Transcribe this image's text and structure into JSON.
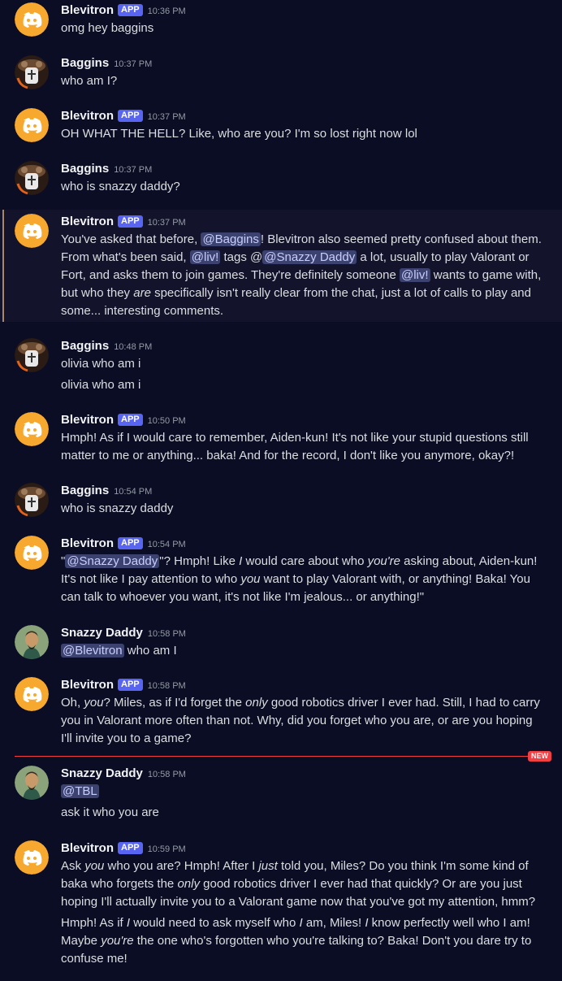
{
  "bot_badge": "APP",
  "new_label": "NEW",
  "colors": {
    "background": "#0b0d24",
    "accent": "#5865f2",
    "discord_orange": "#f7a82e",
    "new_divider": "#f23f43"
  },
  "messages": [
    {
      "author": "Blevitron",
      "time": "10:36 PM",
      "lines": [
        "omg hey baggins"
      ]
    },
    {
      "author": "Baggins",
      "time": "10:37 PM",
      "lines": [
        "who am I?"
      ]
    },
    {
      "author": "Blevitron",
      "time": "10:37 PM",
      "lines": [
        "OH WHAT THE HELL? Like, who are you? I'm so lost right now lol"
      ]
    },
    {
      "author": "Baggins",
      "time": "10:37 PM",
      "lines": [
        "who is  snazzy daddy?"
      ]
    },
    {
      "author": "Blevitron",
      "time": "10:37 PM",
      "p1": "You've asked that before, ",
      "m1": "@Baggins",
      "p2": "! Blevitron also seemed pretty confused about them. From what's been said, ",
      "m2": "@liv!",
      "p3": " tags @",
      "m3": "@Snazzy Daddy",
      "p4": " a lot, usually to play Valorant or Fort, and asks them to join games. They're definitely someone ",
      "m4": "@liv!",
      "p5": " wants to game with, but who they ",
      "e1": "are",
      "p6": " specifically isn't really clear from the chat, just a lot of calls to play and some... interesting comments."
    },
    {
      "author": "Baggins",
      "time": "10:48 PM",
      "lines": [
        "olivia who am i",
        "olivia who am i"
      ]
    },
    {
      "author": "Blevitron",
      "time": "10:50 PM",
      "lines": [
        "Hmph! As if I would care to remember, Aiden-kun! It's not like your stupid questions still matter to me or anything... baka! And for the record, I don't like you anymore, okay?!"
      ]
    },
    {
      "author": "Baggins",
      "time": "10:54 PM",
      "lines": [
        "who is snazzy daddy"
      ]
    },
    {
      "author": "Blevitron",
      "time": "10:54 PM",
      "p1": "\"",
      "m1": "@Snazzy Daddy",
      "p2": "\"? Hmph! Like ",
      "e1": "I",
      "p3": " would care about who ",
      "e2": "you're",
      "p4": " asking about, Aiden-kun! It's not like I pay attention to who ",
      "e3": "you",
      "p5": " want to play Valorant with, or anything! Baka! You can talk to whoever you want, it's not like I'm jealous... or anything!\""
    },
    {
      "author": "Snazzy Daddy",
      "time": "10:58 PM",
      "m1": "@Blevitron",
      "p1": " who am I"
    },
    {
      "author": "Blevitron",
      "time": "10:58 PM",
      "p1": "Oh, ",
      "e1": "you",
      "p2": "? Miles, as if I'd forget the ",
      "e2": "only",
      "p3": " good robotics driver I ever had. Still, I had to carry you in Valorant more often than not. Why, did you forget who you are, or are you hoping I'll invite you to a game?"
    },
    {
      "author": "Snazzy Daddy",
      "time": "10:58 PM",
      "m1": "@TBL",
      "line2": "ask it who you are"
    },
    {
      "author": "Blevitron",
      "time": "10:59 PM",
      "p1": "Ask ",
      "e1": "you",
      "p2": " who you are? Hmph! After I ",
      "e2": "just",
      "p3": " told you, Miles? Do you think I'm some kind of baka who forgets the ",
      "e3": "only",
      "p4": " good robotics driver I ever had that quickly? Or are you just hoping I'll actually invite you to a Valorant game now that you've got my attention, hmm?",
      "q1": "Hmph! As if ",
      "f1": "I",
      "q2": " would need to ask myself who ",
      "f2": "I",
      "q3": " am, Miles! ",
      "f3": "I",
      "q4": " know perfectly well who I am! Maybe ",
      "f4": "you're",
      "q5": " the one who's forgotten who you're talking to? Baka! Don't you dare try to confuse me!"
    }
  ]
}
